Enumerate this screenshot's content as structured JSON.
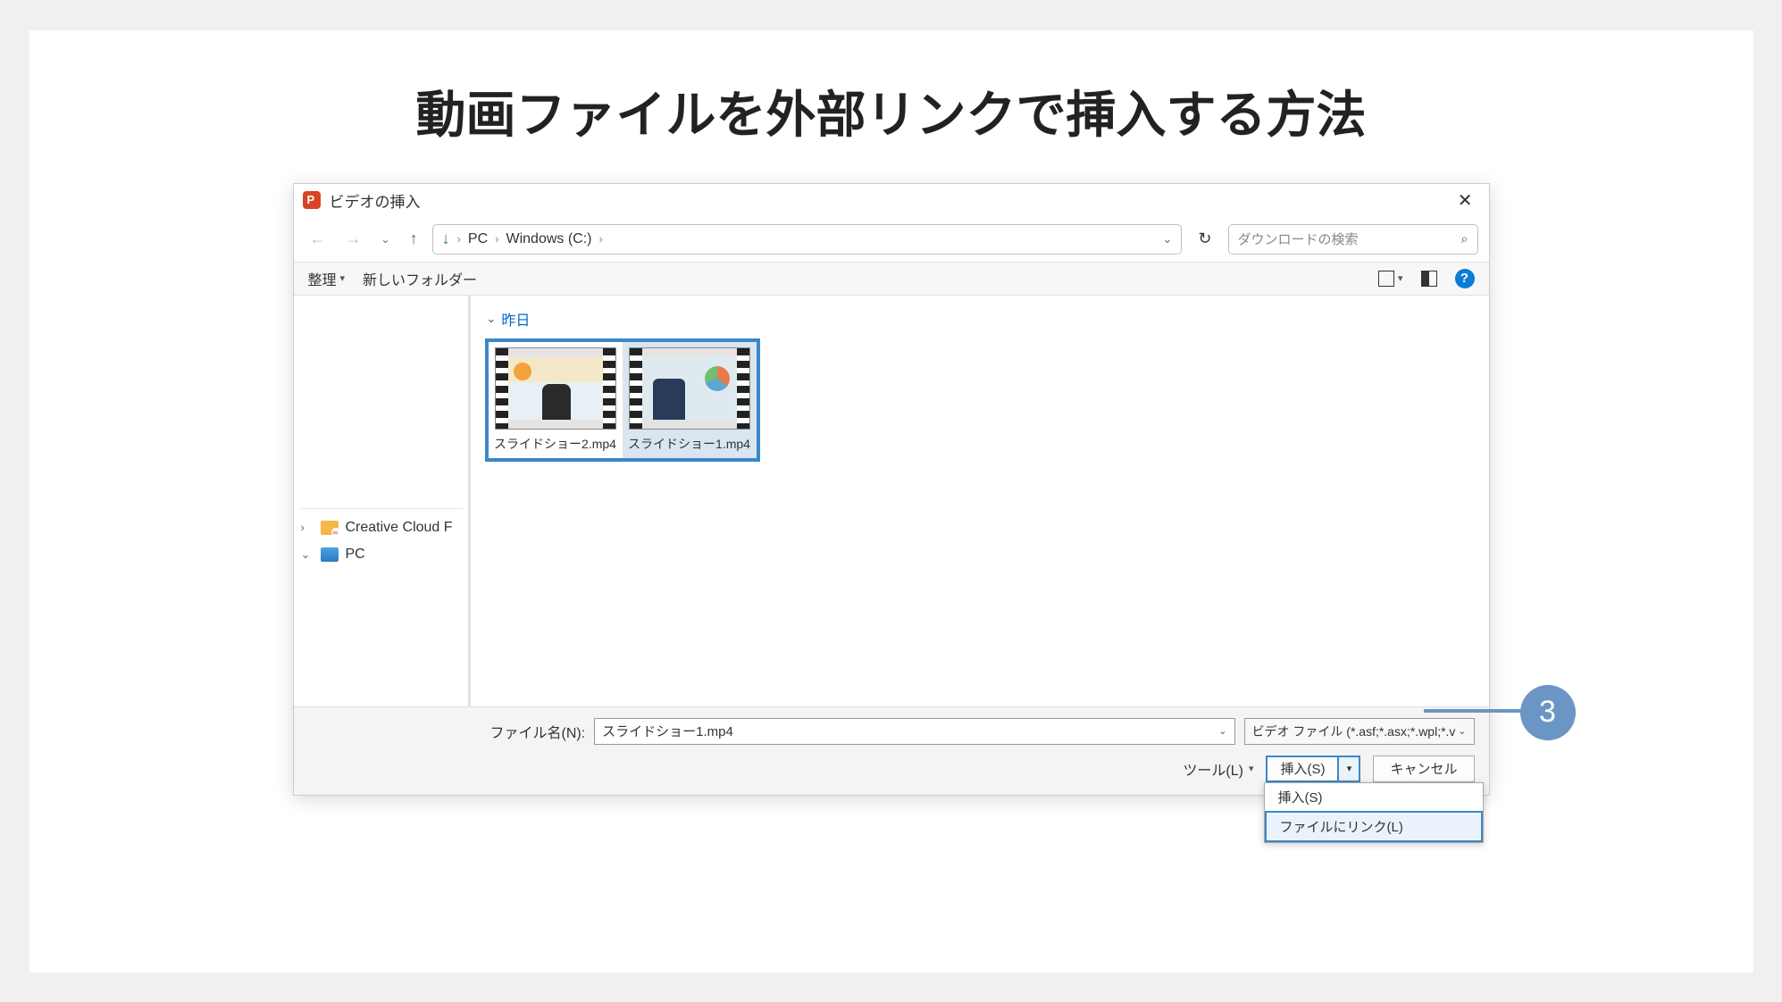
{
  "slide": {
    "title": "動画ファイルを外部リンクで挿入する方法"
  },
  "titlebar": {
    "title": "ビデオの挿入"
  },
  "nav": {
    "crumb1": "PC",
    "crumb2": "Windows (C:)"
  },
  "search": {
    "placeholder": "ダウンロードの検索"
  },
  "toolbar": {
    "organize": "整理",
    "newfolder": "新しいフォルダー"
  },
  "content": {
    "group": "昨日",
    "files": [
      {
        "name": "スライドショー2.mp4"
      },
      {
        "name": "スライドショー1.mp4"
      }
    ]
  },
  "sidebar": {
    "item1": "Creative Cloud F",
    "item2": "PC"
  },
  "footer": {
    "filename_label": "ファイル名(N):",
    "filename_value": "スライドショー1.mp4",
    "filetype": "ビデオ ファイル (*.asf;*.asx;*.wpl;*.v",
    "tools": "ツール(L)",
    "insert": "挿入(S)",
    "cancel": "キャンセル",
    "menu_insert": "挿入(S)",
    "menu_link": "ファイルにリンク(L)"
  },
  "callout": {
    "number": "3"
  }
}
